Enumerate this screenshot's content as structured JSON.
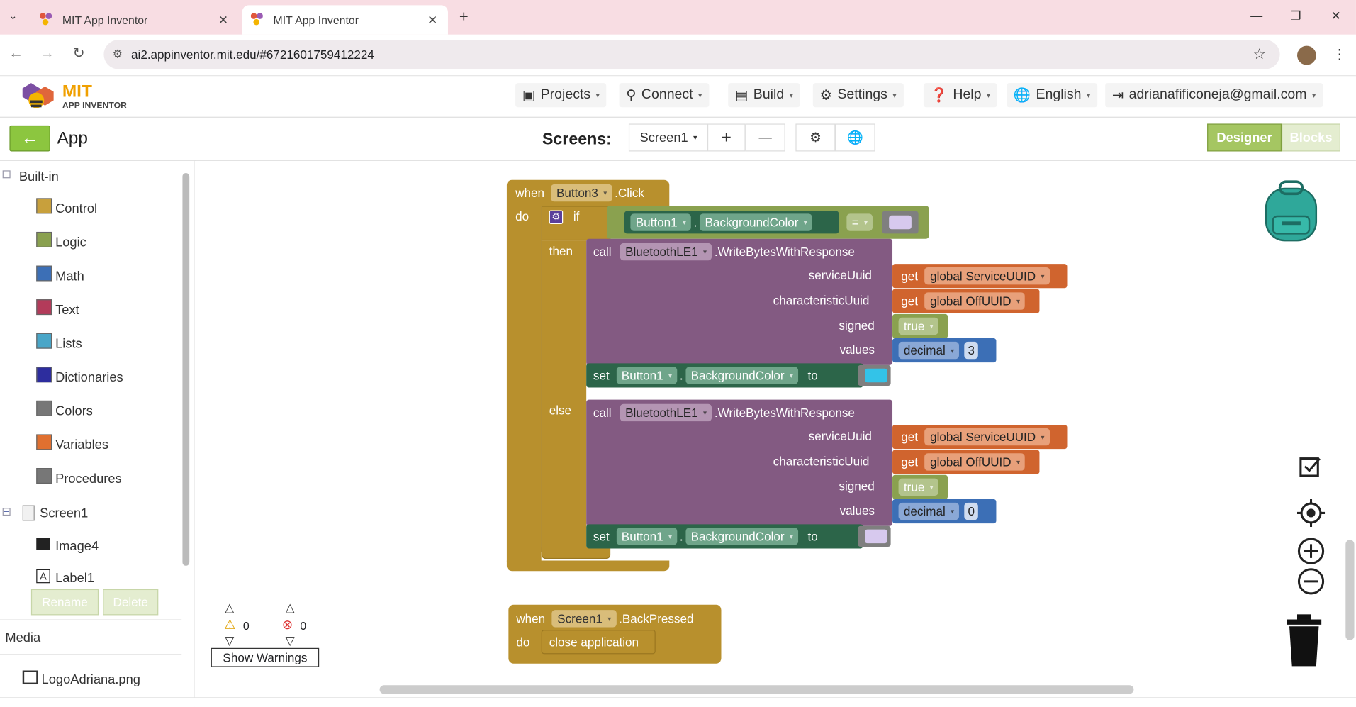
{
  "browser": {
    "tabs": [
      {
        "title": "MIT App Inventor"
      },
      {
        "title": "MIT App Inventor"
      }
    ],
    "url": "ai2.appinventor.mit.edu/#6721601759412224"
  },
  "app_header": {
    "logo_title": "MIT",
    "logo_subtitle": "APP INVENTOR",
    "menus": {
      "projects": "Projects",
      "connect": "Connect",
      "build": "Build",
      "settings": "Settings",
      "help": "Help",
      "language": "English",
      "account": "adrianafificoneja@gmail.com"
    }
  },
  "toolbar": {
    "project_name": "App",
    "screens_label": "Screens:",
    "screen_select": "Screen1",
    "add": "+",
    "remove": "—",
    "designer": "Designer",
    "blocks": "Blocks"
  },
  "sidebar": {
    "builtin_label": "Built-in",
    "categories": [
      {
        "label": "Control",
        "color": "#c8a03c"
      },
      {
        "label": "Logic",
        "color": "#8aa14f"
      },
      {
        "label": "Math",
        "color": "#3c6fb6"
      },
      {
        "label": "Text",
        "color": "#b33b5a"
      },
      {
        "label": "Lists",
        "color": "#49a6c8"
      },
      {
        "label": "Dictionaries",
        "color": "#2d2d9e"
      },
      {
        "label": "Colors",
        "color": "#777777"
      },
      {
        "label": "Variables",
        "color": "#e07030"
      },
      {
        "label": "Procedures",
        "color": "#777777"
      }
    ],
    "screen_label": "Screen1",
    "components": [
      "Image4",
      "Label1"
    ],
    "rename": "Rename",
    "delete": "Delete",
    "media_label": "Media",
    "media_file": "LogoAdriana.png"
  },
  "warnings": {
    "warn_count": "0",
    "error_count": "0",
    "show_warnings": "Show Warnings"
  },
  "blocks": {
    "event1": {
      "when": "when",
      "component": "Button3",
      "event": ".Click",
      "do": "do"
    },
    "if": {
      "if": "if",
      "then": "then",
      "else": "else"
    },
    "cond": {
      "component": "Button1",
      "dot": ".",
      "prop": "BackgroundColor",
      "op": "="
    },
    "call1": {
      "call": "call",
      "component": "BluetoothLE1",
      "method": ".WriteBytesWithResponse",
      "serviceUuid": "serviceUuid",
      "characteristicUuid": "characteristicUuid",
      "signed": "signed",
      "values": "values",
      "get": "get",
      "service_var": "global ServiceUUID",
      "char_var": "global OffUUID",
      "signed_val": "true",
      "decimal": "decimal",
      "value": "3"
    },
    "set1": {
      "set": "set",
      "component": "Button1",
      "dot": ".",
      "prop": "BackgroundColor",
      "to": "to",
      "color": "#33c3e8"
    },
    "call2": {
      "call": "call",
      "component": "BluetoothLE1",
      "method": ".WriteBytesWithResponse",
      "serviceUuid": "serviceUuid",
      "characteristicUuid": "characteristicUuid",
      "signed": "signed",
      "values": "values",
      "get": "get",
      "service_var": "global ServiceUUID",
      "char_var": "global OffUUID",
      "signed_val": "true",
      "decimal": "decimal",
      "value": "0"
    },
    "set2": {
      "set": "set",
      "component": "Button1",
      "dot": ".",
      "prop": "BackgroundColor",
      "to": "to",
      "color": "#d7c9ee"
    },
    "event2": {
      "when": "when",
      "component": "Screen1",
      "event": ".BackPressed",
      "do": "do",
      "action": "close application"
    }
  }
}
